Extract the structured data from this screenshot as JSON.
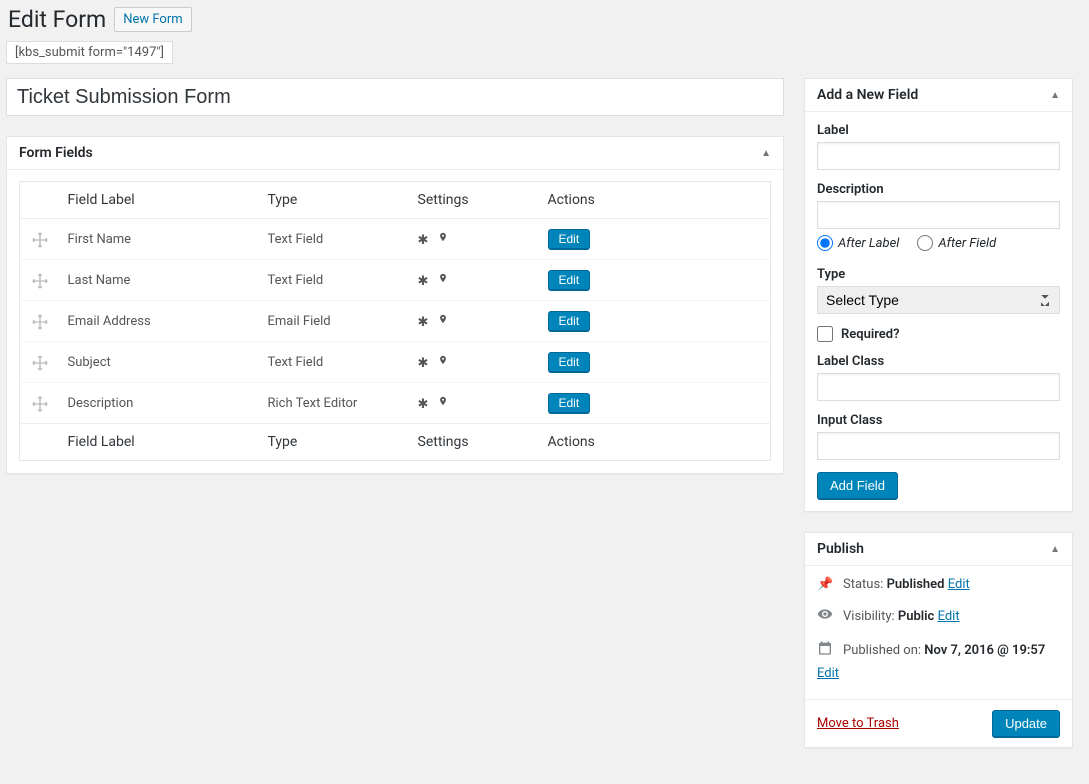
{
  "header": {
    "title": "Edit Form",
    "new_form_label": "New Form",
    "shortcode": "[kbs_submit form=\"1497\"]"
  },
  "form_title": "Ticket Submission Form",
  "form_fields_box": {
    "title": "Form Fields",
    "columns": {
      "drag": "",
      "label": "Field Label",
      "type": "Type",
      "settings": "Settings",
      "actions": "Actions"
    },
    "edit_label": "Edit",
    "rows": [
      {
        "label": "First Name",
        "type": "Text Field"
      },
      {
        "label": "Last Name",
        "type": "Text Field"
      },
      {
        "label": "Email Address",
        "type": "Email Field"
      },
      {
        "label": "Subject",
        "type": "Text Field"
      },
      {
        "label": "Description",
        "type": "Rich Text Editor"
      }
    ]
  },
  "add_field_box": {
    "title": "Add a New Field",
    "label_label": "Label",
    "description_label": "Description",
    "after_label": "After Label",
    "after_field": "After Field",
    "type_label": "Type",
    "type_placeholder": "Select Type",
    "required_label": "Required?",
    "label_class_label": "Label Class",
    "input_class_label": "Input Class",
    "add_field_button": "Add Field"
  },
  "publish_box": {
    "title": "Publish",
    "status_label": "Status:",
    "status_value": "Published",
    "visibility_label": "Visibility:",
    "visibility_value": "Public",
    "published_on_label": "Published on:",
    "published_on_value": "Nov 7, 2016 @ 19:57",
    "edit_label": "Edit",
    "trash_label": "Move to Trash",
    "update_label": "Update"
  }
}
